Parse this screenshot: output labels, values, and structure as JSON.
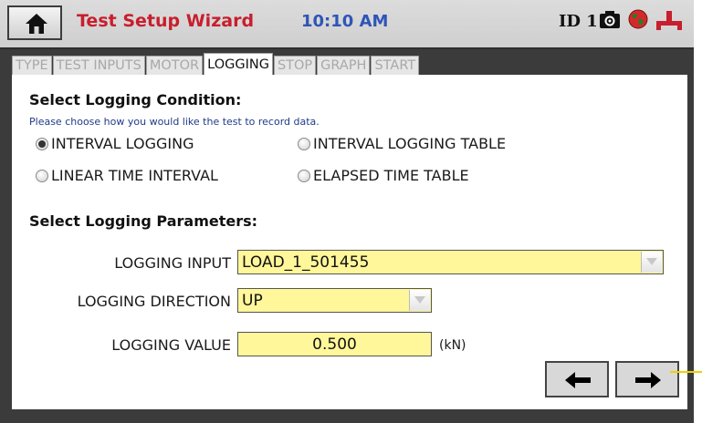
{
  "header": {
    "title": "Test Setup Wizard",
    "time": "10:10 AM",
    "device_id": "ID 1",
    "icons": [
      "home-icon",
      "camera-icon",
      "globe-icon",
      "connection-icon"
    ]
  },
  "tabs": [
    {
      "label": "TYPE",
      "active": false
    },
    {
      "label": "TEST INPUTS",
      "active": false
    },
    {
      "label": "MOTOR",
      "active": false
    },
    {
      "label": "LOGGING",
      "active": true
    },
    {
      "label": "STOP",
      "active": false
    },
    {
      "label": "GRAPH",
      "active": false
    },
    {
      "label": "START",
      "active": false
    }
  ],
  "logging_condition": {
    "title": "Select Logging Condition:",
    "hint": "Please choose how you would like the test to record data.",
    "options": [
      {
        "label": "INTERVAL LOGGING",
        "checked": true
      },
      {
        "label": "INTERVAL LOGGING TABLE",
        "checked": false
      },
      {
        "label": "LINEAR TIME INTERVAL",
        "checked": false
      },
      {
        "label": "ELAPSED TIME TABLE",
        "checked": false
      }
    ]
  },
  "logging_parameters": {
    "title": "Select Logging Parameters:",
    "input_label": "LOGGING INPUT",
    "input_value": "LOAD_1_501455",
    "direction_label": "LOGGING DIRECTION",
    "direction_value": "UP",
    "value_label": "LOGGING VALUE",
    "value_value": "0.500",
    "value_unit": "(kN)"
  },
  "navigation": {
    "back_icon": "arrow-left-icon",
    "next_icon": "arrow-right-icon"
  },
  "colors": {
    "title": "#c81e2d",
    "time": "#2e55b8",
    "field_bg": "#fff79a",
    "hint": "#1f3a8a",
    "callout": "#f2d000"
  }
}
